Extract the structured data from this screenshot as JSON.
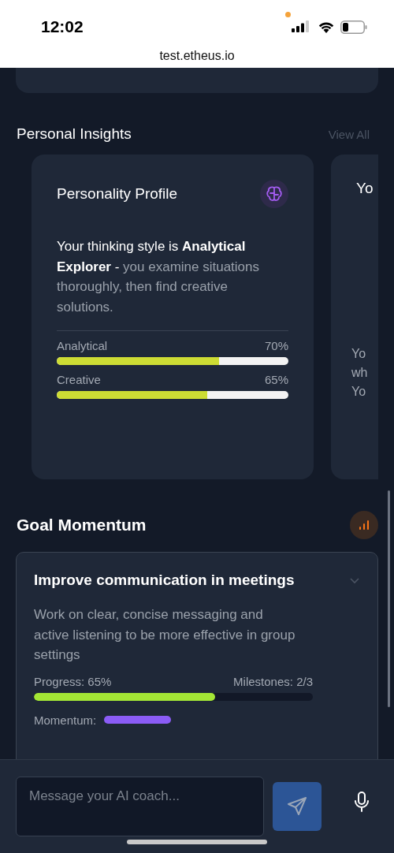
{
  "status_bar": {
    "time": "12:02",
    "url": "test.etheus.io"
  },
  "personal_insights": {
    "title": "Personal Insights",
    "view_all": "View All",
    "cards": [
      {
        "title": "Personality Profile",
        "lead": "Your thinking style is **Analytical Explorer** -",
        "rest": "you examine situations thoroughly, then find creative solutions.",
        "traits": [
          {
            "label": "Analytical",
            "reading": "70%",
            "level": 0.7
          },
          {
            "label": "Creative",
            "reading": "65%",
            "level": 0.65
          }
        ]
      },
      {
        "title": "Yo",
        "lines": [
          "Yo",
          "wh",
          "Yo"
        ]
      }
    ]
  },
  "goal_momentum": {
    "title": "Goal Momentum",
    "goal": {
      "title": "Improve communication in meetings",
      "expanded": false,
      "description": "Work on clear, concise messaging and active listening to be more effective in group settings",
      "progress_label": "Progress: 65%",
      "milestones": "Milestones: 2/3",
      "level": 0.65,
      "momentum": {
        "label": "Momentum:",
        "level": 0.26
      }
    }
  },
  "composer": {
    "placeholder": "Message your AI coach..."
  }
}
